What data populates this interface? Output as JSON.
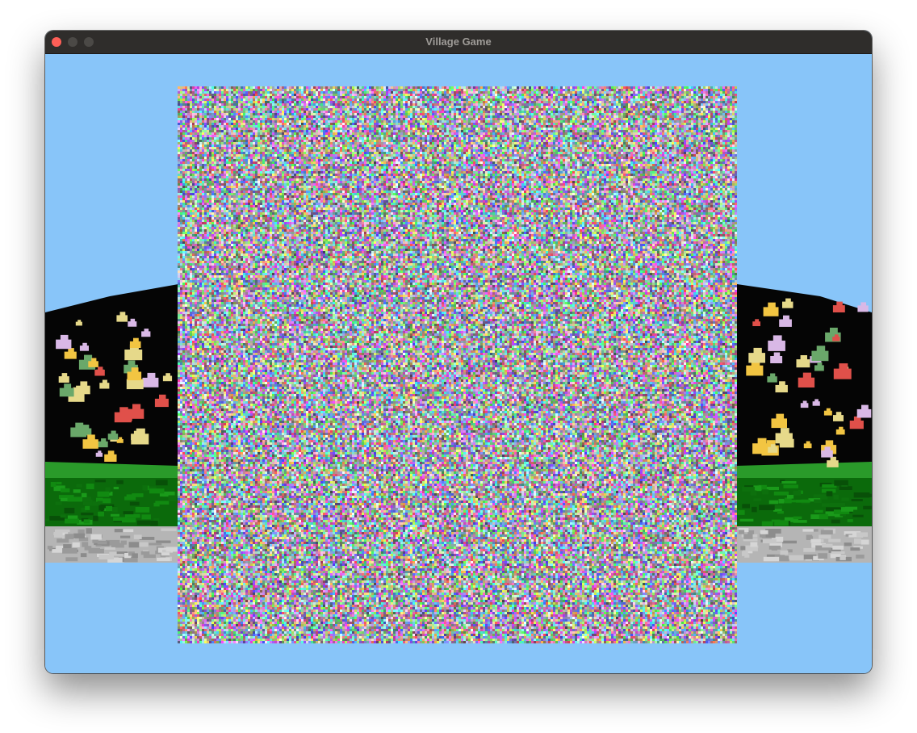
{
  "window": {
    "title": "Village Game",
    "controls": {
      "close": {
        "icon": "close-dot-icon",
        "color": "#fe5f57"
      },
      "minimize": {
        "icon": "minimize-dot-icon",
        "color": "#4b4946"
      },
      "maximize": {
        "icon": "maximize-dot-icon",
        "color": "#4b4946"
      }
    }
  },
  "scene": {
    "sky_color": "#88c5f9",
    "flower_colors": [
      "#e0504a",
      "#f2c542",
      "#d9b8e6",
      "#e6d98a",
      "#6aa86a"
    ],
    "grass_color": "#1a7a1a",
    "dirt_color": "#0a5f0a",
    "stone_color": "#b8b8b8",
    "noise_texture": "corrupted-texture"
  }
}
